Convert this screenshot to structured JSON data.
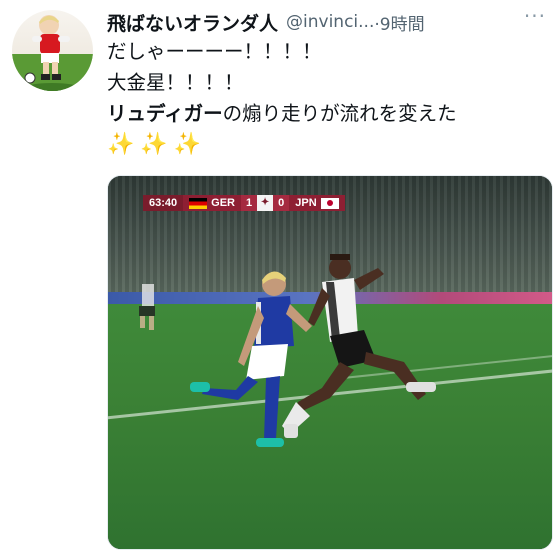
{
  "tweet": {
    "author_name": "飛ばないオランダ人",
    "handle": "@invinci...",
    "time_label": "·9時間",
    "more_label": "···",
    "line1": "だしゃーーーー！！！！",
    "line2": "大金星！！！！",
    "line3_bold": "リュディガー",
    "line3_rest": "の煽り走りが流れを変えた",
    "sparkles": "✨✨✨"
  },
  "media": {
    "clock": "63:40",
    "home_team": "GER",
    "home_score": "1",
    "away_score": "0",
    "away_team": "JPN"
  },
  "colors": {
    "text_primary": "#0f1419",
    "text_secondary": "#536471",
    "scorebug": "#8e1f33"
  }
}
